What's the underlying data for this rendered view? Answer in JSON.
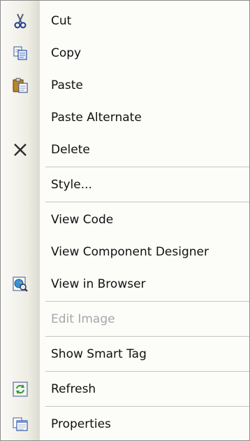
{
  "menu": {
    "items": [
      {
        "label": "Cut",
        "icon": "scissors-icon"
      },
      {
        "label": "Copy",
        "icon": "copy-icon"
      },
      {
        "label": "Paste",
        "icon": "paste-icon"
      },
      {
        "label": "Paste Alternate",
        "icon": ""
      },
      {
        "label": "Delete",
        "icon": "delete-x-icon"
      },
      {
        "label": "Style...",
        "icon": ""
      },
      {
        "label": "View Code",
        "icon": ""
      },
      {
        "label": "View Component Designer",
        "icon": ""
      },
      {
        "label": "View in Browser",
        "icon": "browser-preview-icon"
      },
      {
        "label": "Edit Image",
        "icon": "",
        "disabled": true
      },
      {
        "label": "Show Smart Tag",
        "icon": ""
      },
      {
        "label": "Refresh",
        "icon": "refresh-icon"
      },
      {
        "label": "Properties",
        "icon": "properties-icon"
      }
    ]
  },
  "colors": {
    "menu_background": "#fcfcf9",
    "gutter": "#eeede4",
    "separator": "#c5c5c5",
    "disabled_text": "#a7a6aa",
    "text": "#111111"
  }
}
